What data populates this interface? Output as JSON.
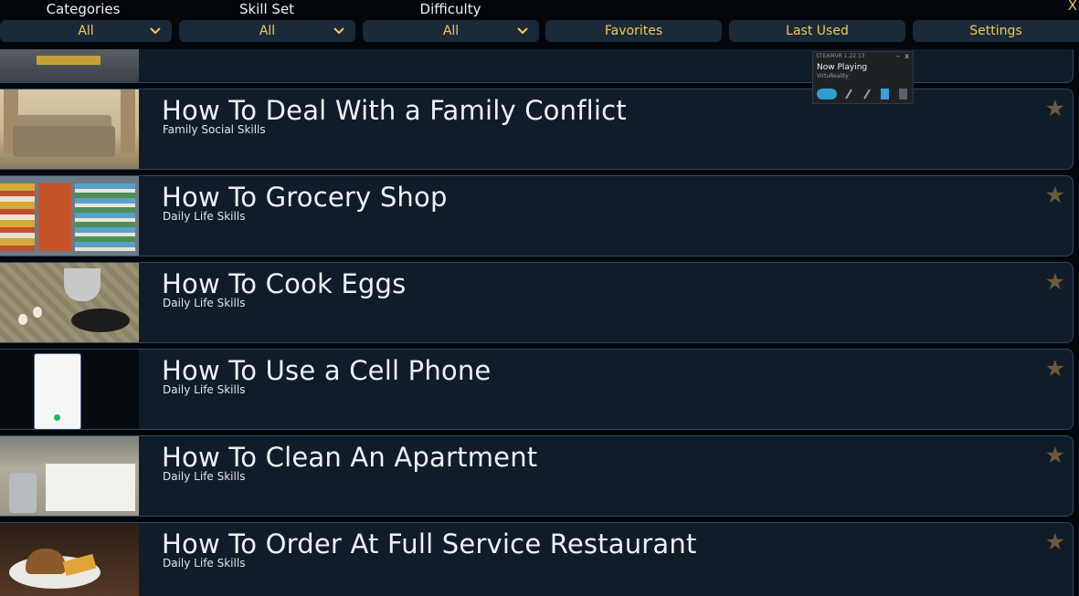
{
  "filters": {
    "categories": {
      "label": "Categories",
      "value": "All"
    },
    "skill_set": {
      "label": "Skill Set",
      "value": "All"
    },
    "difficulty": {
      "label": "Difficulty",
      "value": "All"
    }
  },
  "buttons": {
    "favorites": "Favorites",
    "last_used": "Last Used",
    "settings": "Settings",
    "close": "X"
  },
  "dropdown_icon": "chevron-down-icon",
  "star_icon": "star-icon",
  "colors": {
    "accent": "#f2c75a",
    "button_bg": "#1b2a38",
    "row_bg": "#111c29",
    "row_border": "#274b6a",
    "star": "#6b5a3c"
  },
  "lessons": [
    {
      "title": "How To Deal With a Family Conflict",
      "subtitle": "Family Social Skills",
      "thumb": "living-room"
    },
    {
      "title": "How To Grocery Shop",
      "subtitle": "Daily Life Skills",
      "thumb": "grocery-aisle"
    },
    {
      "title": "How To Cook Eggs",
      "subtitle": "Daily Life Skills",
      "thumb": "kitchen-counter"
    },
    {
      "title": "How To Use a Cell Phone",
      "subtitle": "Daily Life Skills",
      "thumb": "cell-phone"
    },
    {
      "title": "How To Clean An Apartment",
      "subtitle": "Daily Life Skills",
      "thumb": "bathroom"
    },
    {
      "title": "How To Order At Full Service Restaurant",
      "subtitle": "Daily Life Skills",
      "thumb": "burger-plate"
    }
  ],
  "overlay": {
    "header": "STEAMVR 1.22.13",
    "title": "Now Playing",
    "subtitle": "VirtuReality",
    "minimize": "–",
    "close": "x"
  }
}
